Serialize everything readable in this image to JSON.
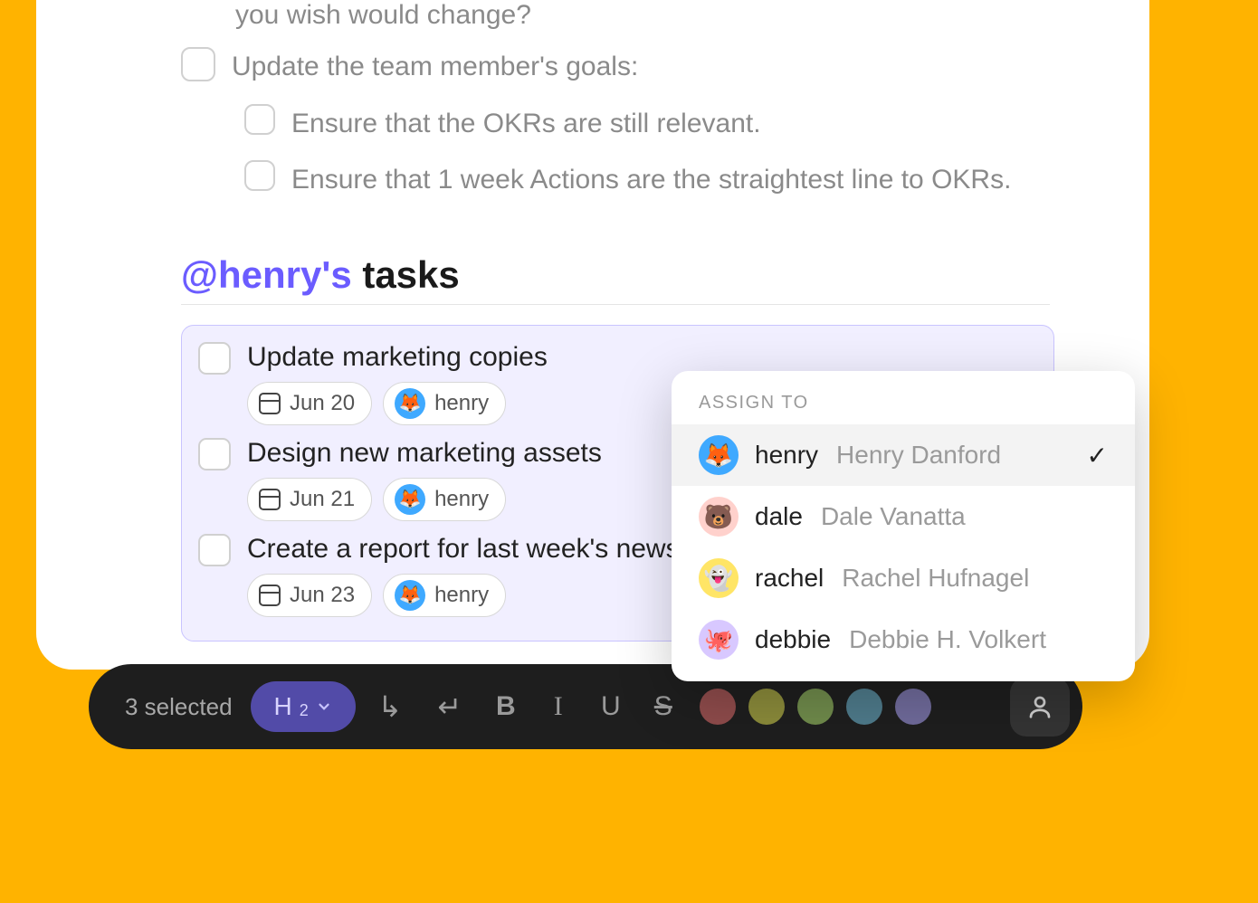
{
  "doc": {
    "wrap_line": "you wish would change?",
    "items": [
      {
        "text": "Update the team member's goals:",
        "indent": false
      },
      {
        "text": "Ensure that the OKRs are still relevant.",
        "indent": true
      },
      {
        "text": "Ensure that 1 week Actions are the straightest line to OKRs.",
        "indent": true
      }
    ]
  },
  "section": {
    "mention": "@henry's",
    "rest": " tasks"
  },
  "tasks": [
    {
      "title": "Update marketing copies",
      "date": "Jun 20",
      "assignee": "henry",
      "avatar": "blue",
      "emoji": "🦊"
    },
    {
      "title": "Design new marketing assets",
      "date": "Jun 21",
      "assignee": "henry",
      "avatar": "blue",
      "emoji": "🦊"
    },
    {
      "title": "Create a report for last week's newsletter",
      "date": "Jun 23",
      "assignee": "henry",
      "avatar": "blue",
      "emoji": "🦊"
    }
  ],
  "assign_popup": {
    "title": "ASSIGN TO",
    "people": [
      {
        "user": "henry",
        "full": "Henry Danford",
        "avatar": "blue",
        "emoji": "🦊",
        "selected": true
      },
      {
        "user": "dale",
        "full": "Dale Vanatta",
        "avatar": "peach",
        "emoji": "🐻",
        "selected": false
      },
      {
        "user": "rachel",
        "full": "Rachel Hufnagel",
        "avatar": "yellow",
        "emoji": "👻",
        "selected": false
      },
      {
        "user": "debbie",
        "full": "Debbie H. Volkert",
        "avatar": "lilac",
        "emoji": "🐙",
        "selected": false
      }
    ]
  },
  "toolbar": {
    "selection": "3 selected",
    "heading_label": "H",
    "heading_level": "2",
    "buttons": {
      "indent": "↳",
      "outdent": "↵",
      "bold": "B",
      "italic": "I",
      "underline": "U",
      "strike": "S"
    },
    "colors": [
      "#8e4b4b",
      "#8a8a3a",
      "#6f8a4b",
      "#4e7a8a",
      "#6f6a9a"
    ]
  }
}
